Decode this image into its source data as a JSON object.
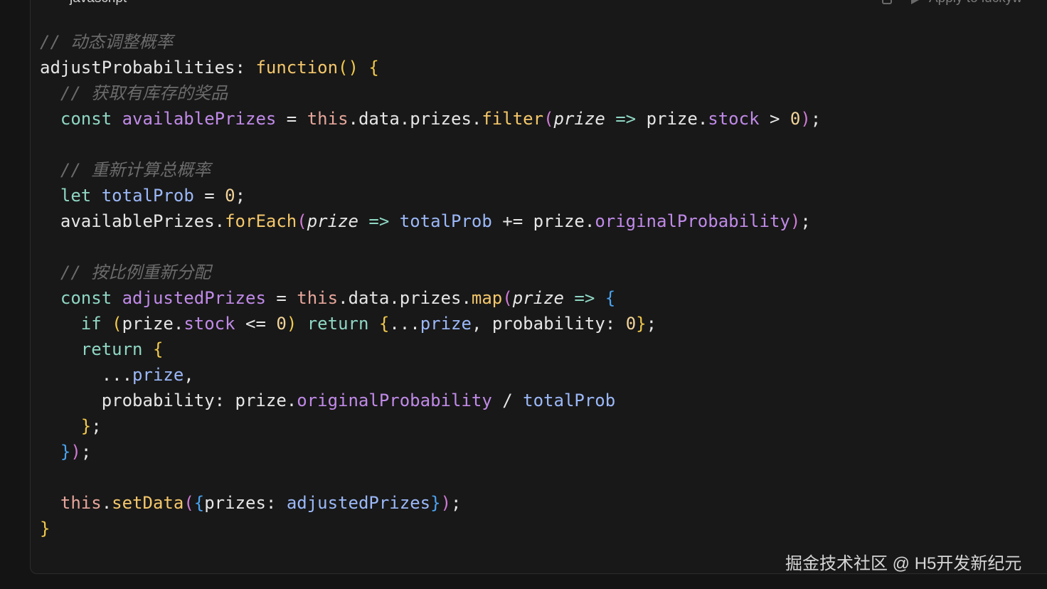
{
  "header": {
    "language_badge": "JS",
    "language_label": "javascript",
    "apply_label": "Apply to luckyw",
    "icons": [
      "copy-icon",
      "play-icon"
    ]
  },
  "code": {
    "lines": [
      [
        {
          "t": "// 动态调整概率",
          "c": "comment"
        }
      ],
      [
        {
          "t": "adjustProbabilities",
          "c": "plain"
        },
        {
          "t": ": ",
          "c": "plain"
        },
        {
          "t": "function",
          "c": "fn"
        },
        {
          "t": "()",
          "c": "b1"
        },
        {
          "t": " ",
          "c": "plain"
        },
        {
          "t": "{",
          "c": "b1"
        }
      ],
      [
        {
          "t": "  ",
          "c": "plain"
        },
        {
          "t": "// 获取有库存的奖品",
          "c": "comment"
        }
      ],
      [
        {
          "t": "  ",
          "c": "plain"
        },
        {
          "t": "const",
          "c": "kw"
        },
        {
          "t": " ",
          "c": "plain"
        },
        {
          "t": "availablePrizes",
          "c": "prop"
        },
        {
          "t": " = ",
          "c": "op"
        },
        {
          "t": "this",
          "c": "this"
        },
        {
          "t": ".data.prizes.",
          "c": "plain"
        },
        {
          "t": "filter",
          "c": "fn"
        },
        {
          "t": "(",
          "c": "b2"
        },
        {
          "t": "prize",
          "c": "param"
        },
        {
          "t": " ",
          "c": "plain"
        },
        {
          "t": "=>",
          "c": "kw"
        },
        {
          "t": " prize.",
          "c": "plain"
        },
        {
          "t": "stock",
          "c": "prop"
        },
        {
          "t": " > ",
          "c": "op"
        },
        {
          "t": "0",
          "c": "num"
        },
        {
          "t": ")",
          "c": "b2"
        },
        {
          "t": ";",
          "c": "plain"
        }
      ],
      [],
      [
        {
          "t": "  ",
          "c": "plain"
        },
        {
          "t": "// 重新计算总概率",
          "c": "comment"
        }
      ],
      [
        {
          "t": "  ",
          "c": "plain"
        },
        {
          "t": "let",
          "c": "kw"
        },
        {
          "t": " ",
          "c": "plain"
        },
        {
          "t": "totalProb",
          "c": "var"
        },
        {
          "t": " = ",
          "c": "op"
        },
        {
          "t": "0",
          "c": "num"
        },
        {
          "t": ";",
          "c": "plain"
        }
      ],
      [
        {
          "t": "  availablePrizes.",
          "c": "plain"
        },
        {
          "t": "forEach",
          "c": "fn"
        },
        {
          "t": "(",
          "c": "b2"
        },
        {
          "t": "prize",
          "c": "param"
        },
        {
          "t": " ",
          "c": "plain"
        },
        {
          "t": "=>",
          "c": "kw"
        },
        {
          "t": " ",
          "c": "plain"
        },
        {
          "t": "totalProb",
          "c": "var"
        },
        {
          "t": " += prize.",
          "c": "plain"
        },
        {
          "t": "originalProbability",
          "c": "prop"
        },
        {
          "t": ")",
          "c": "b2"
        },
        {
          "t": ";",
          "c": "plain"
        }
      ],
      [],
      [
        {
          "t": "  ",
          "c": "plain"
        },
        {
          "t": "// 按比例重新分配",
          "c": "comment"
        }
      ],
      [
        {
          "t": "  ",
          "c": "plain"
        },
        {
          "t": "const",
          "c": "kw"
        },
        {
          "t": " ",
          "c": "plain"
        },
        {
          "t": "adjustedPrizes",
          "c": "prop"
        },
        {
          "t": " = ",
          "c": "op"
        },
        {
          "t": "this",
          "c": "this"
        },
        {
          "t": ".data.prizes.",
          "c": "plain"
        },
        {
          "t": "map",
          "c": "fn"
        },
        {
          "t": "(",
          "c": "b2"
        },
        {
          "t": "prize",
          "c": "param"
        },
        {
          "t": " ",
          "c": "plain"
        },
        {
          "t": "=>",
          "c": "kw"
        },
        {
          "t": " ",
          "c": "plain"
        },
        {
          "t": "{",
          "c": "b3"
        }
      ],
      [
        {
          "t": "    ",
          "c": "plain"
        },
        {
          "t": "if",
          "c": "kw"
        },
        {
          "t": " ",
          "c": "plain"
        },
        {
          "t": "(",
          "c": "b1"
        },
        {
          "t": "prize.",
          "c": "plain"
        },
        {
          "t": "stock",
          "c": "prop"
        },
        {
          "t": " <= ",
          "c": "op"
        },
        {
          "t": "0",
          "c": "num"
        },
        {
          "t": ")",
          "c": "b1"
        },
        {
          "t": " ",
          "c": "plain"
        },
        {
          "t": "return",
          "c": "kw"
        },
        {
          "t": " ",
          "c": "plain"
        },
        {
          "t": "{",
          "c": "b1"
        },
        {
          "t": "...",
          "c": "plain"
        },
        {
          "t": "prize",
          "c": "var"
        },
        {
          "t": ", probability: ",
          "c": "plain"
        },
        {
          "t": "0",
          "c": "num"
        },
        {
          "t": "}",
          "c": "b1"
        },
        {
          "t": ";",
          "c": "plain"
        }
      ],
      [
        {
          "t": "    ",
          "c": "plain"
        },
        {
          "t": "return",
          "c": "kw"
        },
        {
          "t": " ",
          "c": "plain"
        },
        {
          "t": "{",
          "c": "b1"
        }
      ],
      [
        {
          "t": "      ...",
          "c": "plain"
        },
        {
          "t": "prize",
          "c": "var"
        },
        {
          "t": ",",
          "c": "plain"
        }
      ],
      [
        {
          "t": "      probability: prize.",
          "c": "plain"
        },
        {
          "t": "originalProbability",
          "c": "prop"
        },
        {
          "t": " / ",
          "c": "op"
        },
        {
          "t": "totalProb",
          "c": "var"
        }
      ],
      [
        {
          "t": "    ",
          "c": "plain"
        },
        {
          "t": "}",
          "c": "b1"
        },
        {
          "t": ";",
          "c": "plain"
        }
      ],
      [
        {
          "t": "  ",
          "c": "plain"
        },
        {
          "t": "}",
          "c": "b3"
        },
        {
          "t": ")",
          "c": "b2"
        },
        {
          "t": ";",
          "c": "plain"
        }
      ],
      [],
      [
        {
          "t": "  ",
          "c": "plain"
        },
        {
          "t": "this",
          "c": "this"
        },
        {
          "t": ".",
          "c": "plain"
        },
        {
          "t": "setData",
          "c": "fn"
        },
        {
          "t": "(",
          "c": "b2"
        },
        {
          "t": "{",
          "c": "b3"
        },
        {
          "t": "prizes: ",
          "c": "plain"
        },
        {
          "t": "adjustedPrizes",
          "c": "var"
        },
        {
          "t": "}",
          "c": "b3"
        },
        {
          "t": ")",
          "c": "b2"
        },
        {
          "t": ";",
          "c": "plain"
        }
      ],
      [
        {
          "t": "}",
          "c": "b1"
        }
      ]
    ]
  },
  "watermark": "掘金技术社区 @ H5开发新纪元"
}
